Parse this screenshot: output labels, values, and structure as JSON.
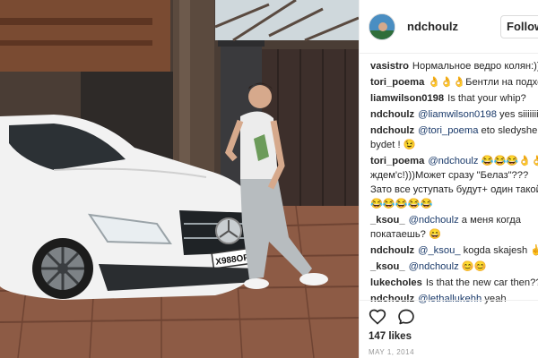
{
  "post": {
    "username": "ndchoulz",
    "follow_label": "Following",
    "likes": "147 likes",
    "date": "MAY 1, 2014",
    "plate_text": "Х988ОР"
  },
  "comments": [
    {
      "user": "vasistro",
      "text": "Нормальное ведро колян:))))"
    },
    {
      "user": "tori_poema",
      "text": "👌👌👌Бентли на подходе)) 🚙"
    },
    {
      "user": "liamwilson0198",
      "text": "Is that your whip?"
    },
    {
      "user": "ndchoulz",
      "mention": "@liamwilson0198",
      "text": " yes siiiiiiir 😁"
    },
    {
      "user": "ndchoulz",
      "mention": "@tori_poema",
      "text": " eto sledysheia bydet ! 😉"
    },
    {
      "user": "tori_poema",
      "mention": "@ndchoulz",
      "text": " 😂😂😂👌👌ждем'с!)))Может сразу \"Белаз\"???Зато все уступать будут+ один такой!😂😂😂😂😂"
    },
    {
      "user": "_ksou_",
      "mention": "@ndchoulz",
      "text": " а меня когда покатаешь? 😄"
    },
    {
      "user": "ndchoulz",
      "mention": "@_ksou_",
      "text": " kogda skajesh ✌"
    },
    {
      "user": "_ksou_",
      "mention": "@ndchoulz",
      "text": " 😊😊"
    },
    {
      "user": "lukecholes",
      "text": "Is that the new car then????"
    },
    {
      "user": "ndchoulz",
      "mention": "@lethallukehh",
      "text": " yeah"
    }
  ],
  "icons": {
    "like": "heart-outline-icon",
    "comment": "speech-bubble-icon"
  },
  "colors": {
    "text": "#262626",
    "mention": "#1a3a6a",
    "date": "#999999",
    "border": "#efefef"
  }
}
